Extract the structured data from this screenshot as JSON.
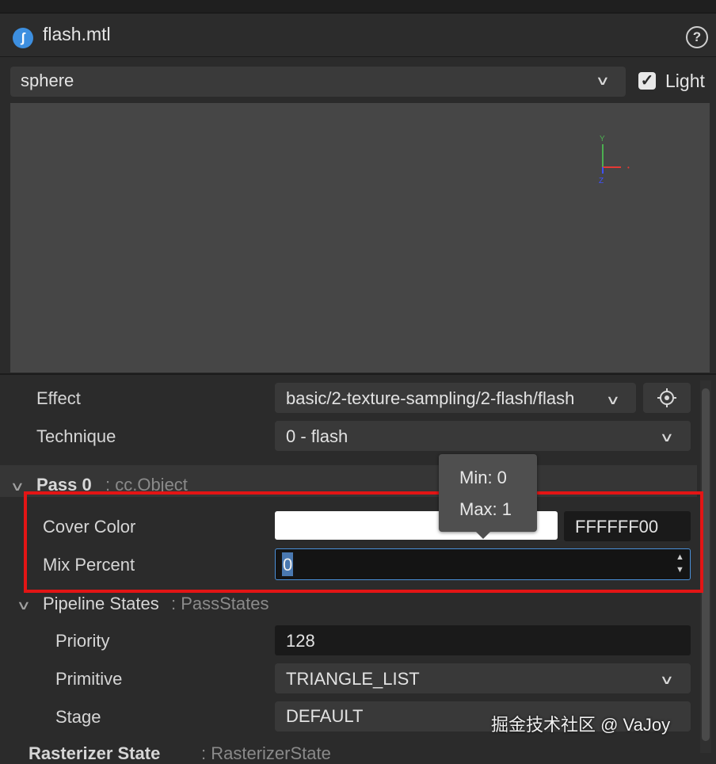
{
  "header": {
    "title": "flash.mtl"
  },
  "preview": {
    "model_select": "sphere",
    "light_label": "Light",
    "light_checked": true
  },
  "gizmo": {
    "y": "Y",
    "x": "X",
    "z": "Z"
  },
  "effect": {
    "label": "Effect",
    "value": "basic/2-texture-sampling/2-flash/flash"
  },
  "technique": {
    "label": "Technique",
    "value": "0 - flash"
  },
  "pass": {
    "title": "Pass 0",
    "type": ": cc.Object"
  },
  "tooltip": {
    "min": "Min: 0",
    "max": "Max: 1"
  },
  "cover_color": {
    "label": "Cover Color",
    "hex": "FFFFFF00",
    "swatch": "#ffffff"
  },
  "mix_percent": {
    "label": "Mix Percent",
    "value": "0"
  },
  "pipeline": {
    "title": "Pipeline States",
    "type": ": PassStates",
    "priority": {
      "label": "Priority",
      "value": "128"
    },
    "primitive": {
      "label": "Primitive",
      "value": "TRIANGLE_LIST"
    },
    "stage": {
      "label": "Stage",
      "value": "DEFAULT"
    }
  },
  "rasterizer": {
    "title": "Rasterizer State",
    "type": ": RasterizerState"
  },
  "watermark": "掘金技术社区 @ VaJoy"
}
